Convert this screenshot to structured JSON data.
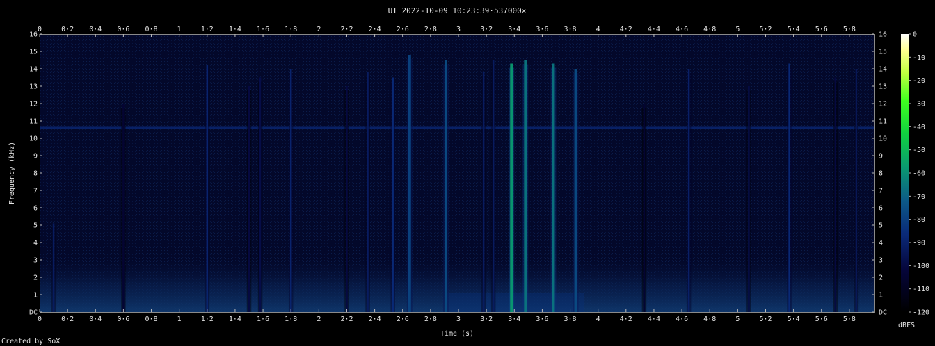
{
  "chart_data": {
    "type": "heatmap",
    "title": "UT 2022-10-09 10:23:39·537000×",
    "xlabel": "Time (s)",
    "ylabel": "Frequency (kHz)",
    "xlim": [
      0,
      5.98
    ],
    "ylim": [
      0,
      16
    ],
    "x_ticks": [
      "0",
      "0·2",
      "0·4",
      "0·6",
      "0·8",
      "1",
      "1·2",
      "1·4",
      "1·6",
      "1·8",
      "2",
      "2·2",
      "2·4",
      "2·6",
      "2·8",
      "3",
      "3·2",
      "3·4",
      "3·6",
      "3·8",
      "4",
      "4·2",
      "4·4",
      "4·6",
      "4·8",
      "5",
      "5·2",
      "5·4",
      "5·6",
      "5·8"
    ],
    "y_ticks": [
      "DC",
      "1",
      "2",
      "3",
      "4",
      "5",
      "6",
      "7",
      "8",
      "9",
      "10",
      "11",
      "12",
      "13",
      "14",
      "15",
      "16"
    ],
    "colorbar": {
      "label": "dBFS",
      "ticks": [
        "0",
        "-10",
        "-20",
        "-30",
        "-40",
        "-50",
        "-60",
        "-70",
        "-80",
        "-90",
        "-100",
        "-110",
        "-120"
      ],
      "range": [
        -120,
        0
      ]
    },
    "tone_line": {
      "freq_khz": 10.6,
      "level_dbfs": -88
    },
    "impulses": [
      {
        "t": 0.1,
        "fmax": 5.1,
        "level": -92
      },
      {
        "t": 0.6,
        "fmax": 12.0,
        "level": -104
      },
      {
        "t": 1.2,
        "fmax": 14.2,
        "level": -88
      },
      {
        "t": 1.5,
        "fmax": 13.0,
        "level": -100
      },
      {
        "t": 1.58,
        "fmax": 13.5,
        "level": -98
      },
      {
        "t": 1.8,
        "fmax": 14.0,
        "level": -88
      },
      {
        "t": 2.2,
        "fmax": 13.0,
        "level": -100
      },
      {
        "t": 2.35,
        "fmax": 13.8,
        "level": -92
      },
      {
        "t": 2.53,
        "fmax": 13.5,
        "level": -86
      },
      {
        "t": 2.65,
        "fmax": 14.8,
        "level": -78
      },
      {
        "t": 2.91,
        "fmax": 14.5,
        "level": -76
      },
      {
        "t": 3.18,
        "fmax": 13.8,
        "level": -92
      },
      {
        "t": 3.25,
        "fmax": 14.5,
        "level": -92
      },
      {
        "t": 3.38,
        "fmax": 14.3,
        "level": -58
      },
      {
        "t": 3.48,
        "fmax": 14.5,
        "level": -66
      },
      {
        "t": 3.68,
        "fmax": 14.3,
        "level": -66
      },
      {
        "t": 3.84,
        "fmax": 14.0,
        "level": -76
      },
      {
        "t": 4.33,
        "fmax": 12.0,
        "level": -104
      },
      {
        "t": 4.65,
        "fmax": 14.0,
        "level": -90
      },
      {
        "t": 5.08,
        "fmax": 13.0,
        "level": -98
      },
      {
        "t": 5.37,
        "fmax": 14.3,
        "level": -86
      },
      {
        "t": 5.7,
        "fmax": 13.5,
        "level": -100
      },
      {
        "t": 5.85,
        "fmax": 14.0,
        "level": -94
      }
    ],
    "low_band": {
      "fmax_khz": 3.0,
      "level_dbfs": -104,
      "peak_range_s": [
        2.9,
        3.9
      ],
      "peak_level": -84
    }
  },
  "footer": {
    "credit": "Created by SoX"
  }
}
